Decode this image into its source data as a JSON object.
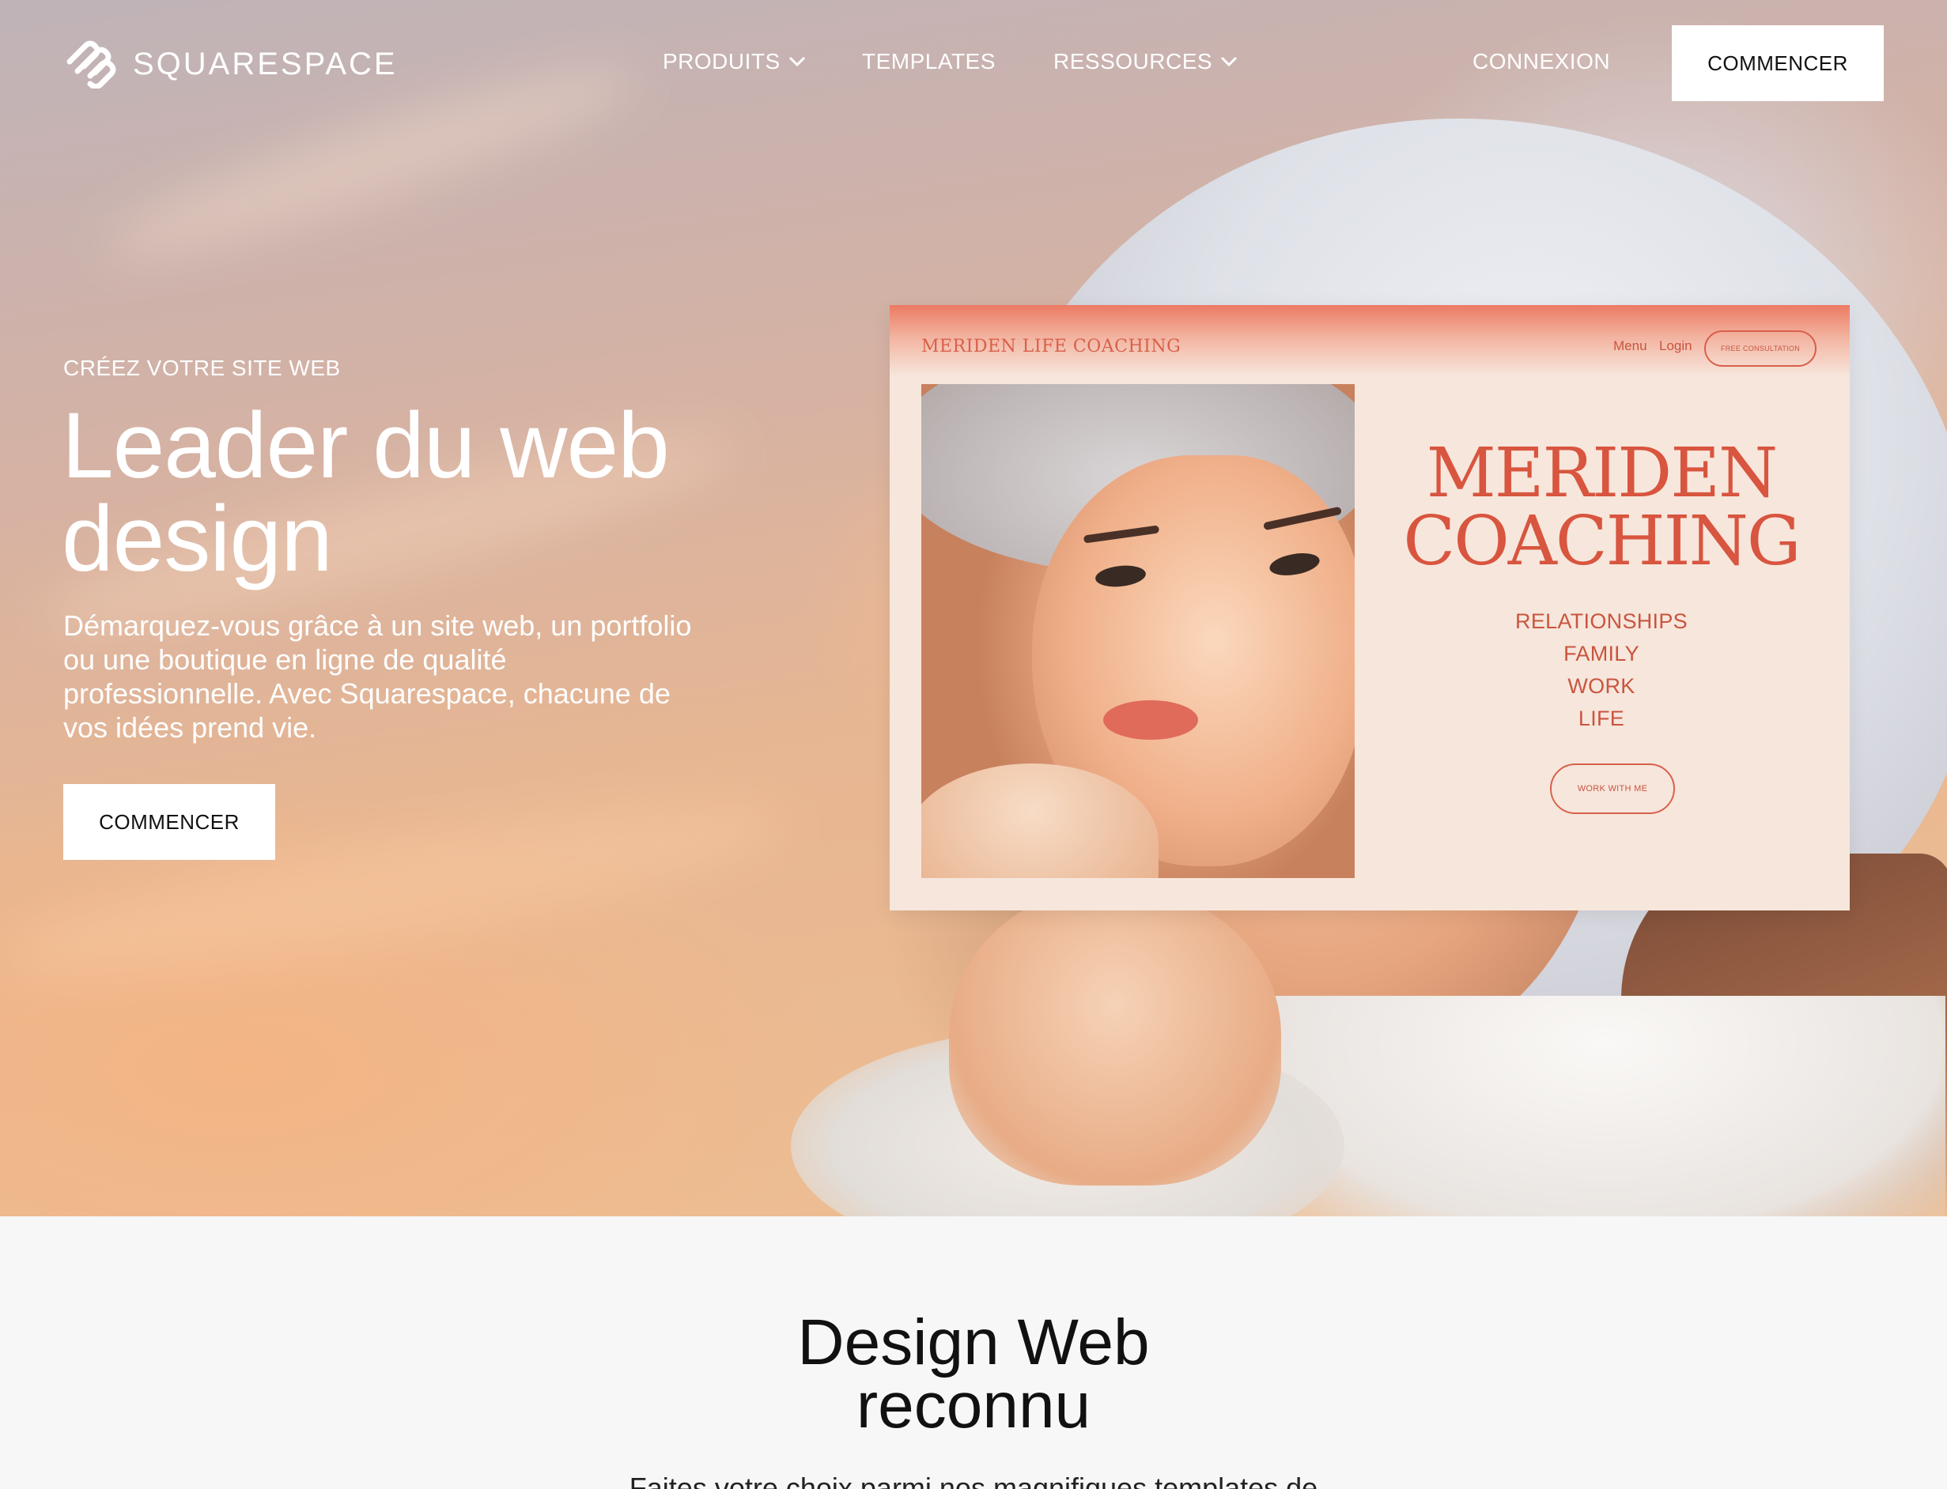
{
  "nav": {
    "logo_text": "SQUARESPACE",
    "items": [
      {
        "label": "PRODUITS"
      },
      {
        "label": "TEMPLATES"
      },
      {
        "label": "RESSOURCES"
      }
    ],
    "login_label": "CONNEXION",
    "cta_label": "COMMENCER"
  },
  "hero": {
    "eyebrow": "CRÉEZ VOTRE SITE WEB",
    "headline": "Leader du web design",
    "subtext": "Démarquez-vous grâce à un site web, un portfolio ou une boutique en ligne de qualité professionnelle. Avec Squarespace, chacune de vos idées prend vie.",
    "cta_label": "COMMENCER"
  },
  "mockup": {
    "brand": "MERIDEN LIFE COACHING",
    "nav_menu": "Menu",
    "nav_login": "Login",
    "free_consultation": "FREE CONSULTATION",
    "title_line1": "MERIDEN",
    "title_line2": "COACHING",
    "list": [
      "RELATIONSHIPS",
      "FAMILY",
      "WORK",
      "LIFE"
    ],
    "work_button": "WORK WITH ME"
  },
  "section2": {
    "title_line1": "Design Web",
    "title_line2": "reconnu",
    "subtitle": "Faites votre choix parmi nos magnifiques templates de"
  },
  "colors": {
    "accent_coral": "#d8604a",
    "cta_bg": "#ffffff",
    "cta_text": "#111111"
  }
}
